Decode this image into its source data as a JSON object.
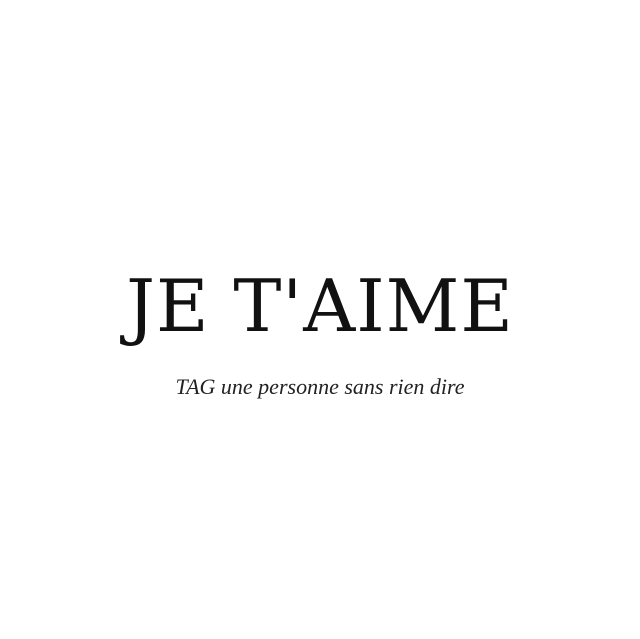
{
  "headline": "JE T'AIME",
  "subline": "TAG une personne sans rien dire",
  "colors": {
    "background": "#ffffff",
    "text": "#111111"
  }
}
